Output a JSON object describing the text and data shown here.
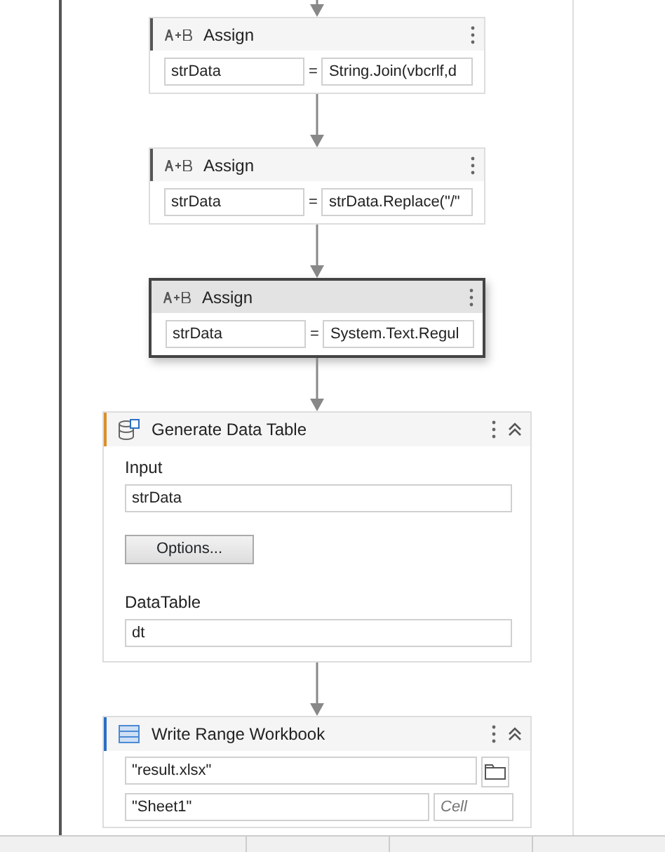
{
  "activities": [
    {
      "kind": "assign",
      "title": "Assign",
      "selected": false,
      "to": "strData",
      "operator": "=",
      "value": "String.Join(vbcrlf,d"
    },
    {
      "kind": "assign",
      "title": "Assign",
      "selected": false,
      "to": "strData",
      "operator": "=",
      "value": "strData.Replace(\"/\""
    },
    {
      "kind": "assign",
      "title": "Assign",
      "selected": true,
      "to": "strData",
      "operator": "=",
      "value": "System.Text.Regul"
    },
    {
      "kind": "generate",
      "title": "Generate Data Table",
      "selected": false,
      "input_label": "Input",
      "input": "strData",
      "button": "Options...",
      "output_label": "DataTable",
      "output": "dt"
    },
    {
      "kind": "write_range",
      "title": "Write Range Workbook",
      "selected": false,
      "workbook": "\"result.xlsx\"",
      "sheet": "\"Sheet1\"",
      "cell_placeholder": "Cell"
    }
  ]
}
